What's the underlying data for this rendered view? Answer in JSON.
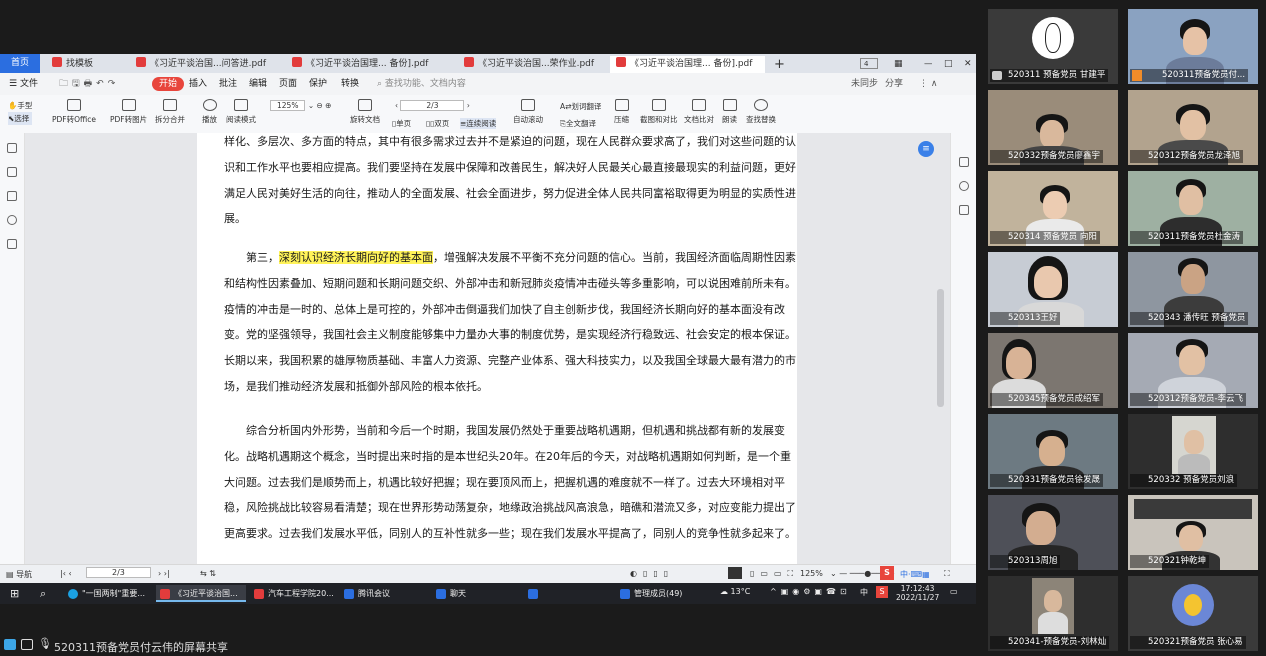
{
  "tabs": [
    {
      "label": "首页",
      "color": "#2b6ee0"
    },
    {
      "label": "找模板",
      "color": "#e23c3c"
    },
    {
      "label": "《习近平谈治国...问答进.pdf",
      "color": "#e23c3c"
    },
    {
      "label": "《习近平谈治国理... 备份].pdf",
      "color": "#e23c3c"
    },
    {
      "label": "《习近平谈治国...荣作业.pdf",
      "color": "#e23c3c"
    },
    {
      "label": "《习近平谈治国理... 备份].pdf",
      "color": "#e23c3c"
    }
  ],
  "tab_extra": {
    "plus": "+",
    "count": "4"
  },
  "menu": {
    "items": [
      "文件",
      "开始",
      "插入",
      "批注",
      "编辑",
      "页面",
      "保护",
      "转换"
    ],
    "search_placeholder": "查找功能、文档内容",
    "right": [
      "未同步",
      "分享"
    ]
  },
  "ribbon": {
    "hand": "手型",
    "select": "选择",
    "tools": [
      "PDF转Office",
      "PDF转图片",
      "拆分合并",
      "播放",
      "阅读模式",
      "旋转文档",
      "单页",
      "双页",
      "连续阅读",
      "自动滚动",
      "划词翻译",
      "全文翻译",
      "压缩",
      "截图和对比",
      "文档比对",
      "朗读",
      "查找替换"
    ],
    "zoom": "125%",
    "page": "2/3"
  },
  "document": {
    "paragraphs": [
      {
        "text": "样化、多层次、多方面的特点，其中有很多需求过去并不是紧迫的问题，现在人民群众要求高了，我们对这些问题的认识和工作水平也要相应提高。我们要坚持在发展中保障和改善民生，解决好人民最关心最直接最现实的利益问题，更好满足人民对美好生活的向往，推动人的全面发展、社会全面进步，努力促进全体人民共同富裕取得更为明显的实质性进展。"
      },
      {
        "pre": "第三，",
        "highlight": "深刻认识经济长期向好的基本面",
        "post": "，增强解决发展不平衡不充分问题的信心。当前，我国经济面临周期性因素和结构性因素叠加、短期问题和长期问题交织、外部冲击和新冠肺炎疫情冲击碰头等多重影响，可以说困难前所未有。疫情的冲击是一时的、总体上是可控的，外部冲击倒逼我们加快了自主创新步伐，我国经济长期向好的基本面没有改变。党的坚强领导，我国社会主义制度能够集中力量办大事的制度优势，是实现经济行稳致远、社会安定的根本保证。长期以来，我国积累的雄厚物质基础、丰富人力资源、完整产业体系、强大科技实力，以及我国全球最大最有潜力的市场，是我们推动经济发展和抵御外部风险的根本依托。"
      },
      {
        "text": "综合分析国内外形势，当前和今后一个时期，我国发展仍然处于重要战略机遇期，但机遇和挑战都有新的发展变化。战略机遇期这个概念，当时提出来时指的是本世纪头20年。在20年后的今天，对战略机遇期如何判断，是一个重大问题。过去我们是顺势而上，机遇比较好把握；现在要顶风而上，把握机遇的难度就不一样了。过去大环境相对平稳，风险挑战比较容易看清楚；现在世界形势动荡复杂，地缘政治挑战风高浪急，暗礁和潜流又多，对应变能力提出了更高要求。过去我们发展水平低，同别人的互补性就多一些；现在我们发展水平提高了，同别人的竞争性就多起来了。"
      }
    ]
  },
  "statusbar": {
    "nav": "导航",
    "page": "2/3",
    "zoom": "125%"
  },
  "taskbar": {
    "items": [
      {
        "label": "\"一国两制\"重要..."
      },
      {
        "label": "《习近平谈治国..."
      },
      {
        "label": "汽车工程学院20..."
      },
      {
        "label": "腾讯会议"
      },
      {
        "label": "聊天"
      },
      {
        "label": ""
      },
      {
        "label": "管理成员(49)"
      }
    ],
    "weather": "13°C",
    "ime": "中",
    "time": "17:12:43",
    "date": "2022/11/27"
  },
  "share_text": "520311预备党员付云伟的屏幕共享",
  "participants": [
    "520311 预备党员 甘建平",
    "520311预备党员付...",
    "520332预备党员廖鑫宇",
    "520312预备党员龙泽旭",
    "520314 预备党员 向阳",
    "520311预备党员杜金涛",
    "520313王好",
    "520343 潘传旺 预备党员",
    "520345预备党员成绍军",
    "520312预备党员-李云飞",
    "520331预备党员徐发晟",
    "520332 预备党员刘浪",
    "520313周旭",
    "520321钟乾坤",
    "520341-预备党员-刘林灿",
    "520321预备党员 张心易"
  ],
  "colors": {
    "accent": "#2b6ee0",
    "highlight": "#fff35a",
    "start": "#e8453c"
  }
}
